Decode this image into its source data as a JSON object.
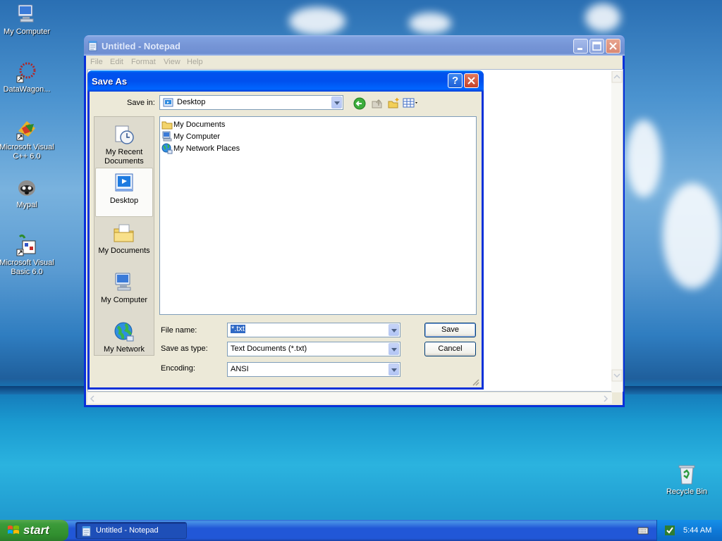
{
  "desktop": {
    "icons": [
      {
        "label": "My Computer"
      },
      {
        "label": "DataWagon..."
      },
      {
        "label": "Microsoft Visual C++ 6.0"
      },
      {
        "label": "Mypal"
      },
      {
        "label": "Microsoft Visual Basic 6.0"
      },
      {
        "label": "Recycle Bin"
      }
    ]
  },
  "notepad": {
    "title": "Untitled - Notepad",
    "menu": [
      "File",
      "Edit",
      "Format",
      "View",
      "Help"
    ]
  },
  "dialog": {
    "title": "Save As",
    "help_glyph": "?",
    "save_in_label": "Save in:",
    "save_in_value": "Desktop",
    "places": [
      {
        "label": "My Recent Documents"
      },
      {
        "label": "Desktop"
      },
      {
        "label": "My Documents"
      },
      {
        "label": "My Computer"
      },
      {
        "label": "My Network"
      }
    ],
    "files": [
      "My Documents",
      "My Computer",
      "My Network Places"
    ],
    "file_name_label": "File name:",
    "file_name_value": "*.txt",
    "save_type_label": "Save as type:",
    "save_type_value": "Text Documents (*.txt)",
    "encoding_label": "Encoding:",
    "encoding_value": "ANSI",
    "save_button": "Save",
    "cancel_button": "Cancel"
  },
  "taskbar": {
    "start_label": "start",
    "task_label": "Untitled - Notepad",
    "clock": "5:44 AM"
  },
  "colors": {
    "xp_blue": "#0831d9",
    "title_active": "#0053ee",
    "start_green": "#3c9b3a"
  }
}
